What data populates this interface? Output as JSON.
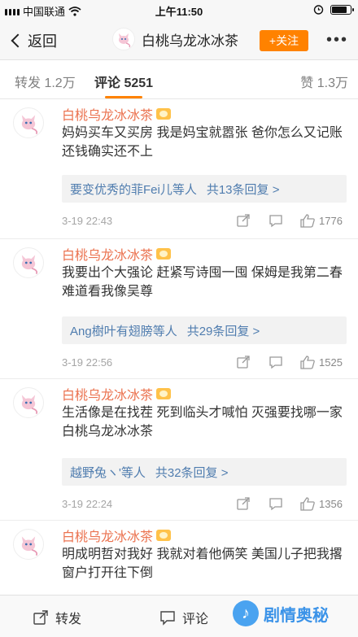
{
  "status_bar": {
    "carrier": "中国联通",
    "time": "上午11:50"
  },
  "nav": {
    "back_label": "返回",
    "title": "白桃乌龙冰冰茶",
    "follow_label": "+关注",
    "more_label": "•••"
  },
  "tabs": {
    "forward": "转发 1.2万",
    "comment": "评论 5251",
    "like": "赞 1.3万"
  },
  "comments": [
    {
      "name": "白桃乌龙冰冰茶",
      "text": "妈妈买车又买房 我是妈宝就嚣张 爸你怎么又记账 还钱确实还不上",
      "replies_who": "要变优秀的菲Fei儿等人",
      "replies_count": "共13条回复 >",
      "time": "3-19 22:43",
      "likes": "1776"
    },
    {
      "name": "白桃乌龙冰冰茶",
      "text": "我要出个大强论 赶紧写诗囤一囤 保姆是我第二春 难道看我像吴尊",
      "replies_who": "Ang樹叶有翅膀等人",
      "replies_count": "共29条回复 >",
      "time": "3-19 22:56",
      "likes": "1525"
    },
    {
      "name": "白桃乌龙冰冰茶",
      "text": "生活像是在找茬 死到临头才喊怕 灭强要找哪一家 白桃乌龙冰冰茶",
      "replies_who": "越野兔ヽ'等人",
      "replies_count": "共32条回复 >",
      "time": "3-19 22:24",
      "likes": "1356"
    },
    {
      "name": "白桃乌龙冰冰茶",
      "text": "明成明哲对我好 我就对着他俩笑 美国儿子把我撂 窗户打开往下倒"
    }
  ],
  "bottom": {
    "forward_label": "转发",
    "comment_label": "评论",
    "watermark": "剧情奥秘"
  },
  "colors": {
    "accent": "#ff8200",
    "username": "#eb7350",
    "link": "#507daf"
  }
}
